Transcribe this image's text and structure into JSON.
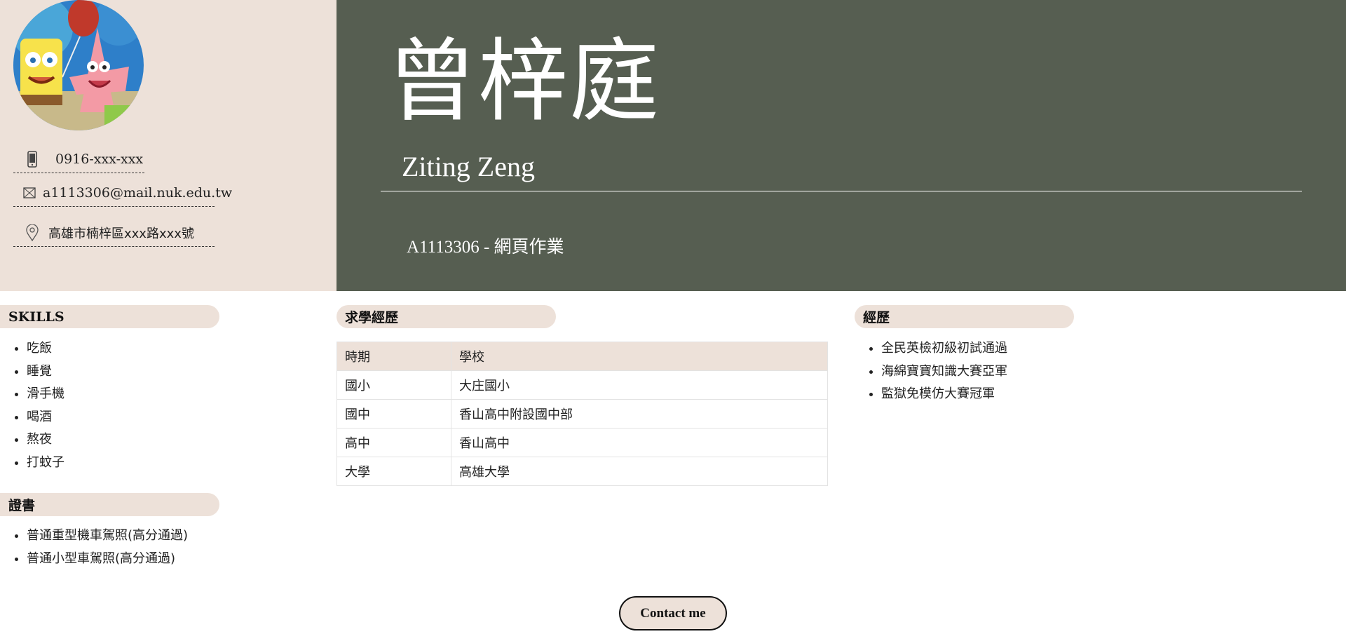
{
  "profile": {
    "name_zh": "曾梓庭",
    "name_en": "Ziting Zeng",
    "subtitle": "A1113306 - 網頁作業",
    "phone": "0916-xxx-xxx",
    "email": "a1113306@mail.nuk.edu.tw",
    "address": "高雄市楠梓區xxx路xxx號"
  },
  "skills": {
    "title": "SKILLS",
    "items": [
      "吃飯",
      "睡覺",
      "滑手機",
      "喝酒",
      "熬夜",
      "打蚊子"
    ]
  },
  "certificates": {
    "title": "證書",
    "items": [
      "普通重型機車駕照(高分通過)",
      "普通小型車駕照(高分通過)"
    ]
  },
  "education": {
    "title": "求學經歷",
    "headers": [
      "時期",
      "學校"
    ],
    "rows": [
      [
        "國小",
        "大庄國小"
      ],
      [
        "國中",
        "香山高中附設國中部"
      ],
      [
        "高中",
        "香山高中"
      ],
      [
        "大學",
        "高雄大學"
      ]
    ]
  },
  "experience": {
    "title": "經歷",
    "items": [
      "全民英檢初級初試通過",
      "海綿寶寶知識大賽亞軍",
      "監獄免模仿大賽冠軍"
    ]
  },
  "contact_button": "Contact me",
  "icons": {
    "phone": "phone-icon",
    "email": "mail-icon",
    "address": "location-pin-icon"
  },
  "colors": {
    "beige": "#ede1d9",
    "olive": "#565e51"
  }
}
